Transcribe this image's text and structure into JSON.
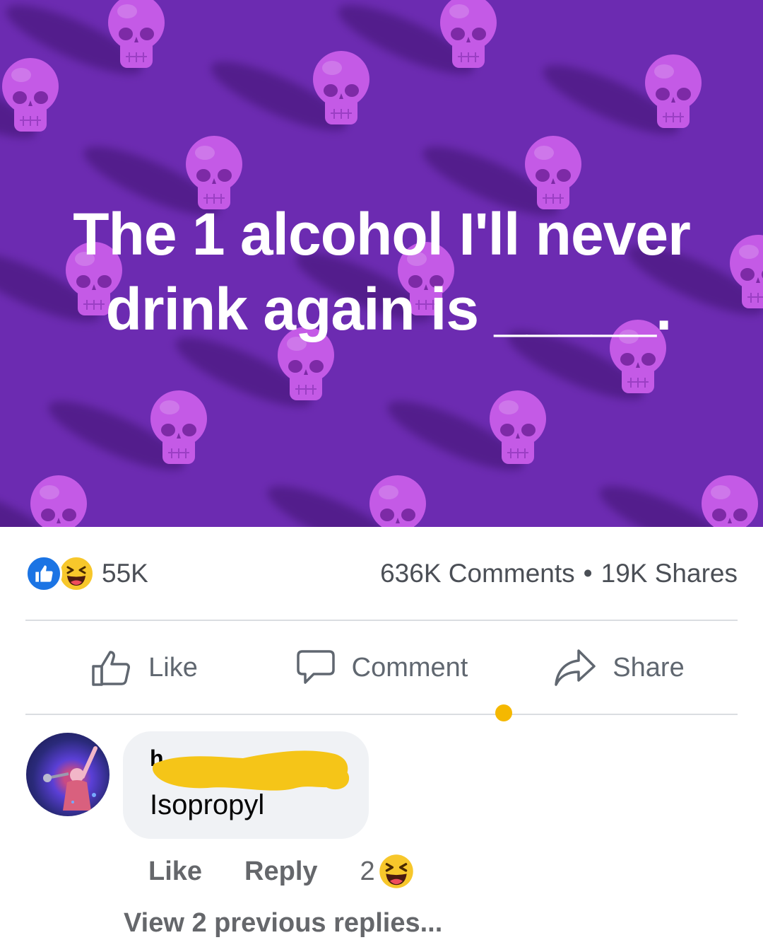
{
  "post": {
    "banner_line1": "The 1 alcohol I'll never",
    "banner_line2": "drink again is _____.",
    "banner_color": "#6c2bb1",
    "skull_color": "#c45ae6"
  },
  "summary": {
    "reaction_icons": [
      "like-icon",
      "haha-icon"
    ],
    "reaction_count": "55K",
    "comments": "636K Comments",
    "separator": "•",
    "shares": "19K Shares"
  },
  "actions": {
    "like": "Like",
    "comment": "Comment",
    "share": "Share"
  },
  "comment": {
    "text": "Isopropyl",
    "like": "Like",
    "reply": "Reply",
    "reaction_count": "2",
    "reaction_icon": "haha-icon",
    "view_replies": "View 2 previous replies..."
  },
  "colors": {
    "like_blue": "#1b74e4",
    "haha_yellow": "#f7c72b",
    "redaction": "#f5c518",
    "muted_text": "#65676b"
  }
}
